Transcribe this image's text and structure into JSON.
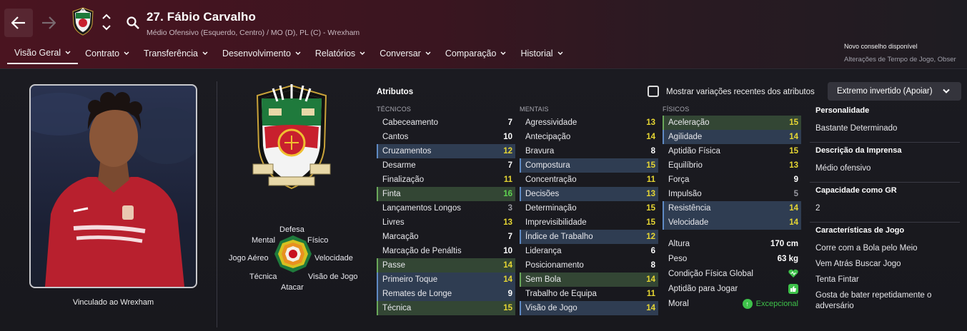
{
  "header": {
    "player_name": "27. Fábio Carvalho",
    "player_position": "Médio Ofensivo (Esquerdo, Centro) / MO (D), PL (C) - Wrexham",
    "tabs": [
      {
        "label": "Visão Geral"
      },
      {
        "label": "Contrato"
      },
      {
        "label": "Transferência"
      },
      {
        "label": "Desenvolvimento"
      },
      {
        "label": "Relatórios"
      },
      {
        "label": "Conversar"
      },
      {
        "label": "Comparação"
      },
      {
        "label": "Historial"
      }
    ],
    "advice_title": "Novo conselho disponível",
    "advice_text": "Alterações de Tempo de Jogo, Obser"
  },
  "profile": {
    "contract_text": "Vinculado ao Wrexham"
  },
  "radar": {
    "labels": {
      "defesa": "Defesa",
      "mental": "Mental",
      "fisico": "Físico",
      "jogo_aereo": "Jogo Aéreo",
      "velocidade": "Velocidade",
      "tecnica": "Técnica",
      "visao_de_jogo": "Visão de Jogo",
      "atacar": "Atacar"
    }
  },
  "attributes": {
    "title": "Atributos",
    "show_recent_label": "Mostrar variações recentes dos atributos",
    "role_selected": "Extremo invertido (Apoiar)",
    "tecnicos_header": "TÉCNICOS",
    "mentais_header": "MENTAIS",
    "fisicos_header": "FÍSICOS",
    "tecnicos": [
      {
        "name": "Cabeceamento",
        "value": "7",
        "hl": "",
        "color": "white"
      },
      {
        "name": "Cantos",
        "value": "10",
        "hl": "",
        "color": "white"
      },
      {
        "name": "Cruzamentos",
        "value": "12",
        "hl": "blue",
        "color": "yellow"
      },
      {
        "name": "Desarme",
        "value": "7",
        "hl": "",
        "color": "white"
      },
      {
        "name": "Finalização",
        "value": "11",
        "hl": "",
        "color": "yellow"
      },
      {
        "name": "Finta",
        "value": "16",
        "hl": "green",
        "color": "green"
      },
      {
        "name": "Lançamentos Longos",
        "value": "3",
        "hl": "",
        "color": "grey"
      },
      {
        "name": "Livres",
        "value": "13",
        "hl": "",
        "color": "yellow"
      },
      {
        "name": "Marcação",
        "value": "7",
        "hl": "",
        "color": "white"
      },
      {
        "name": "Marcação de Penáltis",
        "value": "10",
        "hl": "",
        "color": "white"
      },
      {
        "name": "Passe",
        "value": "14",
        "hl": "green",
        "color": "yellow"
      },
      {
        "name": "Primeiro Toque",
        "value": "14",
        "hl": "blue",
        "color": "yellow"
      },
      {
        "name": "Remates de Longe",
        "value": "9",
        "hl": "blue",
        "color": "white"
      },
      {
        "name": "Técnica",
        "value": "15",
        "hl": "green",
        "color": "yellow"
      }
    ],
    "mentais": [
      {
        "name": "Agressividade",
        "value": "13",
        "hl": "",
        "color": "yellow"
      },
      {
        "name": "Antecipação",
        "value": "14",
        "hl": "",
        "color": "yellow"
      },
      {
        "name": "Bravura",
        "value": "8",
        "hl": "",
        "color": "white"
      },
      {
        "name": "Compostura",
        "value": "15",
        "hl": "blue",
        "color": "yellow"
      },
      {
        "name": "Concentração",
        "value": "11",
        "hl": "",
        "color": "yellow"
      },
      {
        "name": "Decisões",
        "value": "13",
        "hl": "blue",
        "color": "yellow"
      },
      {
        "name": "Determinação",
        "value": "15",
        "hl": "",
        "color": "yellow"
      },
      {
        "name": "Imprevisibilidade",
        "value": "15",
        "hl": "",
        "color": "yellow"
      },
      {
        "name": "Índice de Trabalho",
        "value": "12",
        "hl": "blue",
        "color": "yellow"
      },
      {
        "name": "Liderança",
        "value": "6",
        "hl": "",
        "color": "white"
      },
      {
        "name": "Posicionamento",
        "value": "8",
        "hl": "",
        "color": "white"
      },
      {
        "name": "Sem Bola",
        "value": "14",
        "hl": "green",
        "color": "yellow"
      },
      {
        "name": "Trabalho de Equipa",
        "value": "11",
        "hl": "",
        "color": "yellow"
      },
      {
        "name": "Visão de Jogo",
        "value": "14",
        "hl": "blue",
        "color": "yellow"
      }
    ],
    "fisicos": [
      {
        "name": "Aceleração",
        "value": "15",
        "hl": "green",
        "color": "yellow"
      },
      {
        "name": "Agilidade",
        "value": "14",
        "hl": "blue",
        "color": "yellow"
      },
      {
        "name": "Aptidão Física",
        "value": "15",
        "hl": "",
        "color": "yellow"
      },
      {
        "name": "Equilíbrio",
        "value": "13",
        "hl": "",
        "color": "yellow"
      },
      {
        "name": "Força",
        "value": "9",
        "hl": "",
        "color": "white"
      },
      {
        "name": "Impulsão",
        "value": "5",
        "hl": "",
        "color": "grey"
      },
      {
        "name": "Resistência",
        "value": "14",
        "hl": "blue",
        "color": "yellow"
      },
      {
        "name": "Velocidade",
        "value": "14",
        "hl": "blue",
        "color": "yellow"
      }
    ],
    "physical_info": {
      "altura_label": "Altura",
      "altura_value": "170 cm",
      "peso_label": "Peso",
      "peso_value": "63 kg",
      "condicao_label": "Condição Física Global",
      "aptidao_label": "Aptidão para Jogar",
      "moral_label": "Moral",
      "moral_value": "Excepcional"
    }
  },
  "sidebar": {
    "personalidade_h": "Personalidade",
    "personalidade": "Bastante Determinado",
    "imprensa_h": "Descrição da Imprensa",
    "imprensa": "Médio ofensivo",
    "gr_h": "Capacidade como GR",
    "gr": "2",
    "caracteristicas_h": "Características de Jogo",
    "caracteristicas": [
      "Corre com a Bola pelo Meio",
      "Vem Atrás Buscar Jogo",
      "Tenta Fintar",
      "Gosta de bater repetidamente o adversário"
    ]
  },
  "colors": {
    "header_red": "#4a1420",
    "accent_yellow": "#e6d633",
    "accent_green": "#5fd450",
    "highlight_blue": "#2f3d52",
    "highlight_green": "#334634"
  }
}
